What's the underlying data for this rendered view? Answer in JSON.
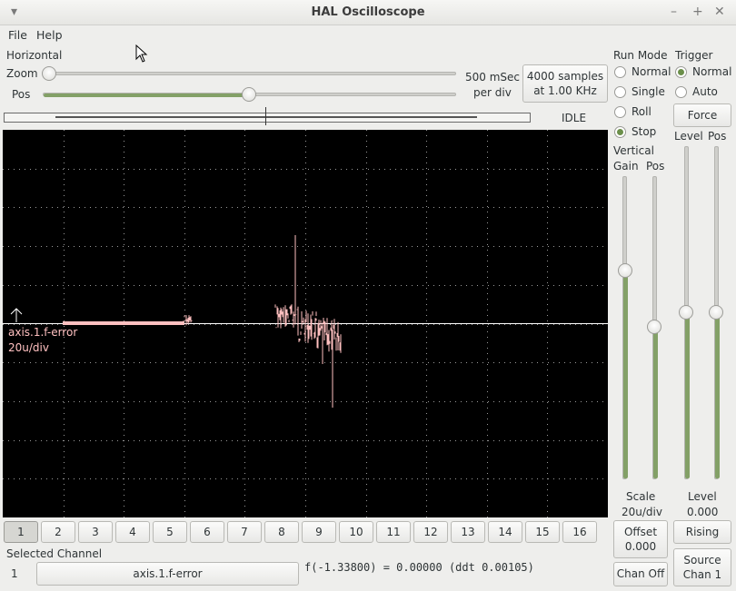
{
  "window": {
    "title": "HAL Oscilloscope"
  },
  "menu": {
    "file": "File",
    "help": "Help"
  },
  "horizontal": {
    "section_label": "Horizontal",
    "zoom_label": "Zoom",
    "pos_label": "Pos",
    "rate_line1": "500 mSec",
    "rate_line2": "per div",
    "samples_line1": "4000 samples",
    "samples_line2": "at 1.00 KHz",
    "zoom_value": 0.0,
    "pos_value": 0.5
  },
  "status": {
    "state": "IDLE"
  },
  "run_mode": {
    "label": "Run Mode",
    "options": [
      "Normal",
      "Single",
      "Roll",
      "Stop"
    ],
    "selected": "Stop"
  },
  "trigger": {
    "label": "Trigger",
    "options": [
      "Normal",
      "Auto"
    ],
    "selected": "Normal",
    "force_label": "Force",
    "level_label": "Level",
    "pos_label": "Pos",
    "level_value_label": "Level",
    "level_value": "0.000",
    "edge_button": "Rising",
    "source_line1": "Source",
    "source_line2": "Chan  1"
  },
  "vertical": {
    "label": "Vertical",
    "gain_label": "Gain",
    "pos_label": "Pos",
    "scale_label": "Scale",
    "scale_value": "20u/div",
    "offset_line1": "Offset",
    "offset_line2": "0.000",
    "chan_off": "Chan Off"
  },
  "trace": {
    "channel_name": "axis.1.f-error",
    "channel_scale": "20u/div",
    "color": "#ffc0c0"
  },
  "channels": [
    "1",
    "2",
    "3",
    "4",
    "5",
    "6",
    "7",
    "8",
    "9",
    "10",
    "11",
    "12",
    "13",
    "14",
    "15",
    "16"
  ],
  "selected_channel": {
    "label": "Selected Channel",
    "number": "1",
    "name": "axis.1.f-error",
    "readout": "f(-1.33800) =  0.00000 (ddt  0.00105)"
  }
}
